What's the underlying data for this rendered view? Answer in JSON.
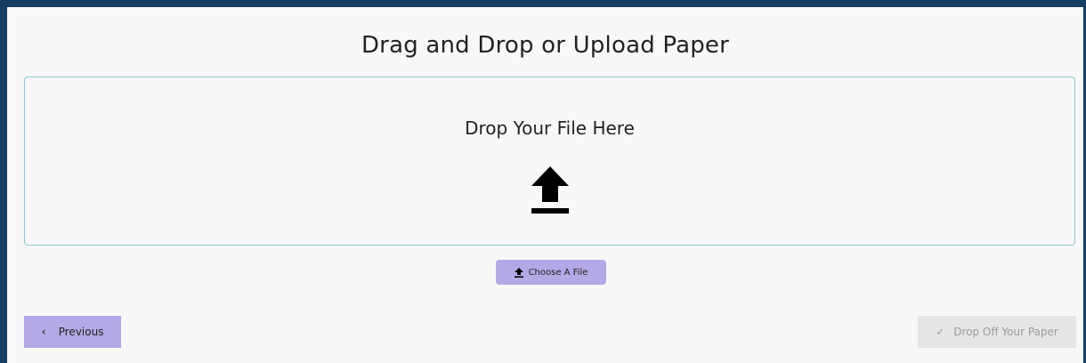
{
  "page": {
    "title": "Drag and Drop or Upload Paper"
  },
  "dropzone": {
    "label": "Drop Your File Here",
    "icon": "upload-icon"
  },
  "choose_button": {
    "label": "Choose A File",
    "icon": "upload-icon"
  },
  "footer": {
    "previous_label": "Previous",
    "previous_icon": "chevron-left-icon",
    "drop_off_label": "Drop Off Your Paper",
    "drop_off_icon": "check-icon"
  },
  "colors": {
    "frame_border": "#163d63",
    "accent": "#b5a8e6",
    "dropzone_border": "#8ec8cf",
    "disabled_bg": "#e6e6e6",
    "disabled_text": "#9a9a9a"
  }
}
